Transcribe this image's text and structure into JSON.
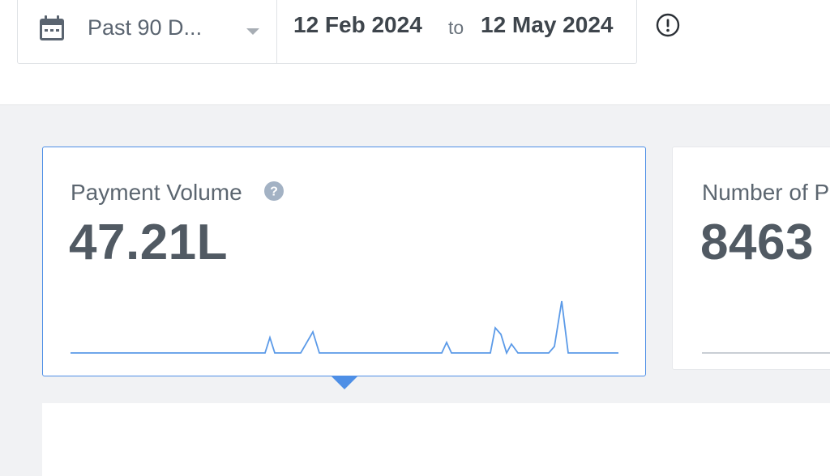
{
  "filter": {
    "preset_label": "Past 90 D...",
    "start_date": "12 Feb 2024",
    "to_label": "to",
    "end_date": "12 May 2024"
  },
  "icons": {
    "calendar": "calendar-icon",
    "dropdown": "chevron-down-icon",
    "info": "exclamation-circle-icon",
    "help": "question-circle-icon"
  },
  "cards": [
    {
      "title": "Payment Volume",
      "value": "47.21L",
      "selected": true,
      "sparkline": [
        0,
        0,
        0,
        0,
        0,
        0,
        0,
        0,
        0,
        0,
        0,
        0,
        0,
        0,
        0,
        0,
        0,
        0,
        0,
        0,
        0,
        0,
        0,
        0,
        0,
        0,
        0,
        0,
        0,
        0,
        0,
        0,
        0,
        0,
        0,
        0,
        0,
        0,
        0,
        0,
        0,
        0,
        0,
        0,
        0,
        0,
        0,
        0,
        0,
        0,
        0,
        0,
        0,
        0,
        0,
        0,
        0,
        0,
        0,
        0,
        0,
        0,
        0,
        0,
        0,
        0,
        0,
        0,
        0,
        0,
        0,
        0,
        0,
        0,
        0,
        0,
        0,
        0,
        0,
        0,
        0,
        0,
        0,
        0,
        0,
        0,
        0,
        0,
        0,
        0
      ]
    },
    {
      "title": "Number of P",
      "value": "8463",
      "selected": false
    }
  ],
  "colors": {
    "accent": "#4e8fe6",
    "text": "#515a63",
    "background": "#f1f2f4"
  }
}
